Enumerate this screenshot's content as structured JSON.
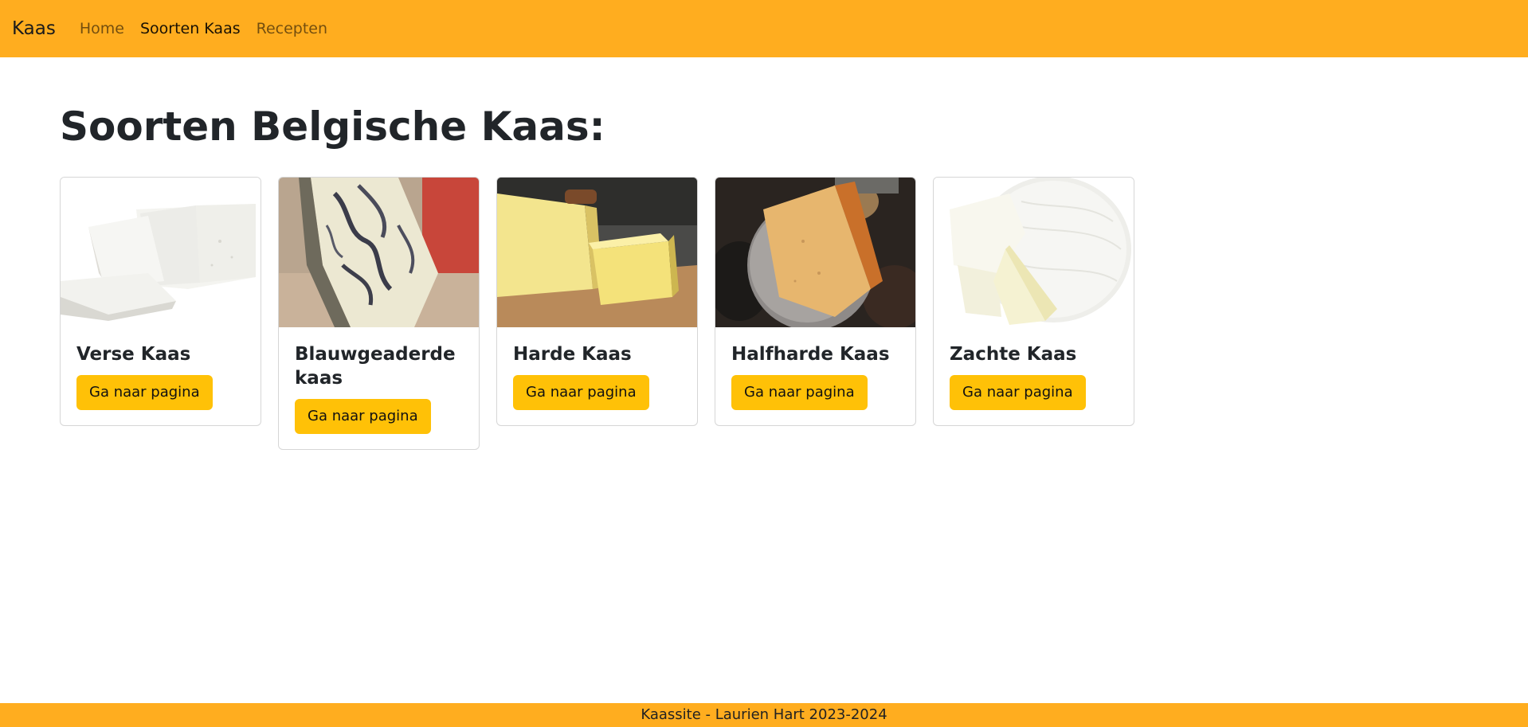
{
  "nav": {
    "brand": "Kaas",
    "links": [
      {
        "label": "Home"
      },
      {
        "label": "Soorten Kaas"
      },
      {
        "label": "Recepten"
      }
    ]
  },
  "main": {
    "title": "Soorten Belgische Kaas:",
    "cards": [
      {
        "title": "Verse Kaas",
        "button": "Ga naar pagina"
      },
      {
        "title": "Blauwgeaderde kaas",
        "button": "Ga naar pagina"
      },
      {
        "title": "Harde Kaas",
        "button": "Ga naar pagina"
      },
      {
        "title": "Halfharde Kaas",
        "button": "Ga naar pagina"
      },
      {
        "title": "Zachte Kaas",
        "button": "Ga naar pagina"
      }
    ]
  },
  "footer": {
    "text": "Kaassite - Laurien Hart 2023-2024"
  },
  "colors": {
    "navbar_bg": "#ffad1f",
    "button_bg": "#ffc107"
  }
}
